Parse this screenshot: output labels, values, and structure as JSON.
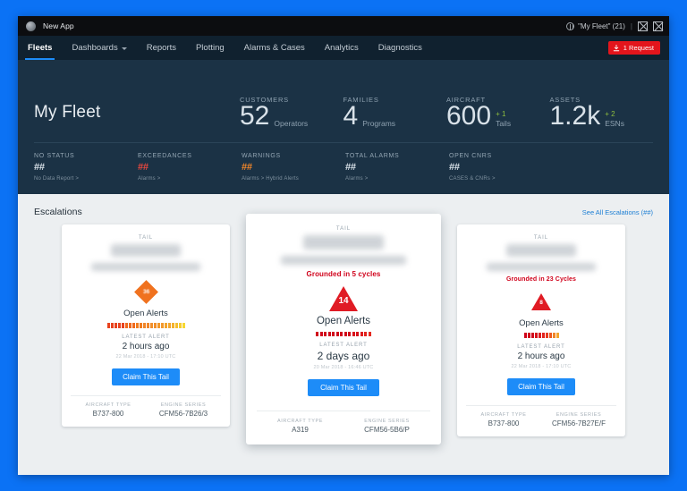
{
  "titlebar": {
    "app_name": "New App",
    "fleet_label": "\"My Fleet\" (21)",
    "separator": "|"
  },
  "nav": {
    "items": [
      {
        "label": "Fleets",
        "active": true,
        "caret": false
      },
      {
        "label": "Dashboards",
        "active": false,
        "caret": true
      },
      {
        "label": "Reports",
        "active": false,
        "caret": false
      },
      {
        "label": "Plotting",
        "active": false,
        "caret": false
      },
      {
        "label": "Alarms & Cases",
        "active": false,
        "caret": false
      },
      {
        "label": "Analytics",
        "active": false,
        "caret": false
      },
      {
        "label": "Diagnostics",
        "active": false,
        "caret": false
      }
    ],
    "request_button": "1 Request"
  },
  "hero": {
    "title": "My Fleet",
    "kpis": [
      {
        "label": "CUSTOMERS",
        "value": "52",
        "delta": "",
        "unit": "Operators"
      },
      {
        "label": "FAMILIES",
        "value": "4",
        "delta": "",
        "unit": "Programs"
      },
      {
        "label": "AIRCRAFT",
        "value": "600",
        "delta": "+ 1",
        "unit": "Tails"
      },
      {
        "label": "ASSETS",
        "value": "1.2k",
        "delta": "+ 2",
        "unit": "ESNs"
      }
    ],
    "minis": [
      {
        "label": "NO STATUS",
        "value": "##",
        "color": "",
        "link": "No Data Report >"
      },
      {
        "label": "EXCEEDANCES",
        "value": "##",
        "color": "red",
        "link": "Alarms >"
      },
      {
        "label": "WARNINGS",
        "value": "##",
        "color": "orange",
        "link": "Alarms > Hybrid Alerts"
      },
      {
        "label": "TOTAL ALARMS",
        "value": "##",
        "color": "",
        "link": "Alarms >"
      },
      {
        "label": "OPEN CNRS",
        "value": "##",
        "color": "",
        "link": "CASES & CNRs >"
      }
    ]
  },
  "escalations": {
    "title": "Escalations",
    "see_all_link": "See All Escalations (##)",
    "shared": {
      "tail_label": "TAIL",
      "open_alerts_label": "Open Alerts",
      "latest_alert_label": "LATEST ALERT",
      "claim_button": "Claim This Tail",
      "aircraft_type_label": "AIRCRAFT TYPE",
      "engine_series_label": "ENGINE SERIES"
    },
    "cards": [
      {
        "featured": false,
        "grounded": "",
        "badge_shape": "diamond",
        "badge_count": "36",
        "dot_count": 22,
        "dot_colors": [
          "#e8431f",
          "#e8431f",
          "#e8431f",
          "#e8431f",
          "#e8431f",
          "#ef6a1e",
          "#ef6a1e",
          "#ef6a1e",
          "#f07d1f",
          "#f07d1f",
          "#f0862a",
          "#f0862a",
          "#f18f2a",
          "#f18f2a",
          "#f2982b",
          "#f2982b",
          "#f3a52c",
          "#f3a52c",
          "#f4b22d",
          "#f5bf2e",
          "#f6cc30",
          "#f7d832"
        ],
        "latest_alert": "2 hours ago",
        "timestamp": "22 Mar 2018 - 17:10 UTC",
        "aircraft_type": "B737-800",
        "engine_series": "CFM56-7B26/3"
      },
      {
        "featured": true,
        "grounded": "Grounded in 5 cycles",
        "badge_shape": "triangle",
        "badge_count": "14",
        "dot_count": 14,
        "dot_colors": [
          "#d0021b",
          "#d0021b",
          "#d0021b",
          "#d0021b",
          "#d0021b",
          "#d0021b",
          "#d0021b",
          "#d0021b",
          "#d0021b",
          "#d8101b",
          "#d8101b",
          "#de1a1c",
          "#e2231d",
          "#e5291e"
        ],
        "latest_alert": "2 days ago",
        "timestamp": "20 Mar 2018 - 16:46 UTC",
        "aircraft_type": "A319",
        "engine_series": "CFM56-5B6/P"
      },
      {
        "featured": false,
        "grounded": "Grounded in 23 Cycles",
        "badge_shape": "triangle",
        "badge_count": "8",
        "dot_count": 10,
        "dot_colors": [
          "#d0021b",
          "#d0021b",
          "#d0021b",
          "#d6101b",
          "#dd1a1c",
          "#e2231d",
          "#e73a1e",
          "#ec5a1e",
          "#f0862a",
          "#f3a52c"
        ],
        "latest_alert": "2 hours ago",
        "timestamp": "22 Mar 2018 - 17:10 UTC",
        "aircraft_type": "B737-800",
        "engine_series": "CFM56-7B27E/F"
      }
    ]
  },
  "colors": {
    "page_background": "#0b72f5",
    "hero_background": "#1b3245",
    "nav_background": "#10212f",
    "accent_blue": "#1d8cf8",
    "danger_red": "#e3151c",
    "warning_orange": "#f0862a",
    "delta_green": "#8fbf3f"
  }
}
